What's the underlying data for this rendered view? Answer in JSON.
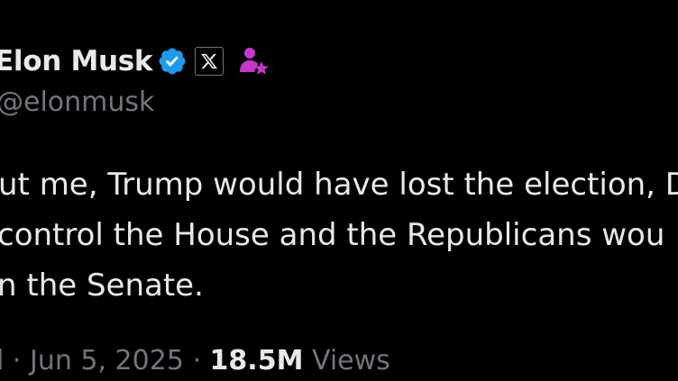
{
  "author": {
    "display_name": "Elon Musk",
    "handle": "@elonmusk",
    "icons": [
      "verified-badge-icon",
      "x-affiliation-icon",
      "affiliate-person-star-icon"
    ]
  },
  "tweet": {
    "lines": [
      "ut me, Trump would have lost the election, D",
      "control the House and the Republicans wou",
      "n the Senate."
    ]
  },
  "meta": {
    "time_fragment": "l",
    "separator": "·",
    "date": "Jun 5, 2025",
    "views_count": "18.5M",
    "views_label": "Views"
  },
  "colors": {
    "background": "#000000",
    "text": "#e7e9ea",
    "muted": "#71767b",
    "verified": "#1d9bf0",
    "affiliate": "#c936cc"
  }
}
